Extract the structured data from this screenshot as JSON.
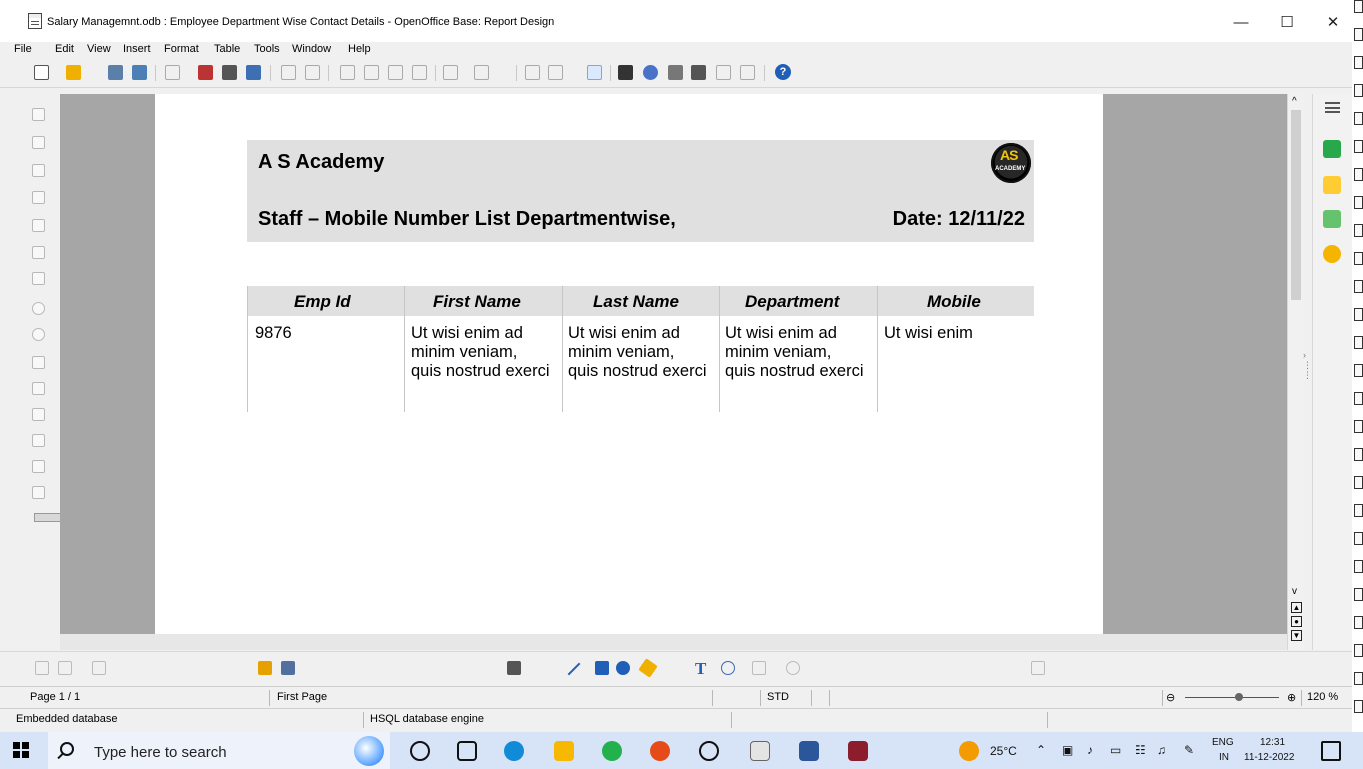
{
  "window": {
    "title": "Salary Managemnt.odb : Employee Department Wise Contact Details - OpenOffice Base: Report Design",
    "min_label": "—",
    "max_label": "☐",
    "close_label": "✕"
  },
  "menu": [
    "File",
    "Edit",
    "View",
    "Insert",
    "Format",
    "Table",
    "Tools",
    "Window",
    "Help"
  ],
  "toolbar": {
    "help_label": "?"
  },
  "report": {
    "company": "A S Academy",
    "title": "Staff – Mobile Number List Departmentwise,",
    "date": "Date: 12/11/22",
    "logo_top": "AS",
    "logo_bottom": "ACADEMY",
    "columns": [
      "Emp Id",
      "First Name",
      "Last Name",
      "Department",
      "Mobile"
    ],
    "row": {
      "emp_id": "9876",
      "first_name": "Ut wisi enim ad minim veniam, quis nostrud exerci",
      "last_name": "Ut wisi enim ad minim veniam, quis nostrud exerci",
      "department": "Ut wisi enim ad minim veniam, quis nostrud exerci",
      "mobile": "Ut wisi enim"
    }
  },
  "status": {
    "page": "Page 1 / 1",
    "section": "First Page",
    "mode": "STD",
    "zoom": "120 %",
    "zoom_minus": "⊖",
    "zoom_plus": "⊕",
    "embedded": "Embedded database",
    "engine": "HSQL database engine"
  },
  "taskbar": {
    "search_placeholder": "Type here to search",
    "weather": "25°C",
    "language": "ENG",
    "region": "IN",
    "time": "12:31",
    "date": "11-12-2022"
  },
  "icons": {
    "start": "windows-start-icon",
    "search": "search-icon",
    "help": "help-icon",
    "logo": "academy-logo"
  },
  "colors": {
    "page_bg": "#ffffff",
    "workspace_bg": "#a6a6a6",
    "header_bg": "#e0e0e0",
    "accent": "#1f5fb8",
    "taskbar_bg": "#d7e4f7"
  }
}
